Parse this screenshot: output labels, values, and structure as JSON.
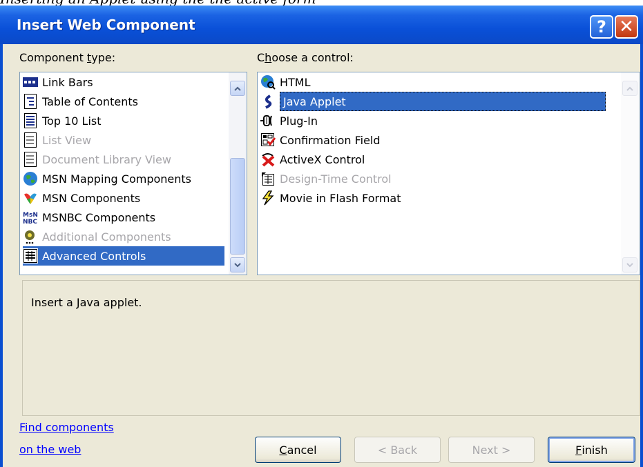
{
  "caption": "Inserting an Applet using the the active form",
  "window": {
    "title": "Insert Web Component",
    "help_glyph": "?",
    "close_glyph": "✕"
  },
  "component_type": {
    "label_pre": "Component ",
    "label_accel": "t",
    "label_post": "ype:",
    "items": [
      {
        "label": "Link Bars",
        "icon": "link-bars-icon",
        "enabled": true,
        "selected": false
      },
      {
        "label": "Table of Contents",
        "icon": "table-of-contents-icon",
        "enabled": true,
        "selected": false
      },
      {
        "label": "Top 10 List",
        "icon": "top-10-list-icon",
        "enabled": true,
        "selected": false
      },
      {
        "label": "List View",
        "icon": "list-view-icon",
        "enabled": false,
        "selected": false
      },
      {
        "label": "Document Library View",
        "icon": "document-library-icon",
        "enabled": false,
        "selected": false
      },
      {
        "label": "MSN Mapping Components",
        "icon": "globe-icon",
        "enabled": true,
        "selected": false
      },
      {
        "label": "MSN Components",
        "icon": "msn-butterfly-icon",
        "enabled": true,
        "selected": false
      },
      {
        "label": "MSNBC Components",
        "icon": "msnbc-icon",
        "enabled": true,
        "selected": false
      },
      {
        "label": "Additional Components",
        "icon": "gear-icon",
        "enabled": false,
        "selected": false
      },
      {
        "label": "Advanced Controls",
        "icon": "advanced-controls-icon",
        "enabled": true,
        "selected": true
      }
    ]
  },
  "choose_control": {
    "label_pre": "C",
    "label_accel": "h",
    "label_post": "oose a control:",
    "items": [
      {
        "label": "HTML",
        "icon": "html-globe-icon",
        "enabled": true,
        "selected": false
      },
      {
        "label": "Java Applet",
        "icon": "java-applet-icon",
        "enabled": true,
        "selected": true
      },
      {
        "label": "Plug-In",
        "icon": "plug-in-icon",
        "enabled": true,
        "selected": false
      },
      {
        "label": "Confirmation Field",
        "icon": "confirmation-field-icon",
        "enabled": true,
        "selected": false
      },
      {
        "label": "ActiveX Control",
        "icon": "activex-icon",
        "enabled": true,
        "selected": false
      },
      {
        "label": "Design-Time Control",
        "icon": "design-time-icon",
        "enabled": false,
        "selected": false
      },
      {
        "label": "Movie in Flash Format",
        "icon": "flash-movie-icon",
        "enabled": true,
        "selected": false
      }
    ]
  },
  "description": "Insert a Java applet.",
  "find_link": {
    "line1": "Find components",
    "line2": "on the web"
  },
  "buttons": {
    "cancel": {
      "accel": "C",
      "rest": "ancel"
    },
    "back": "< Back",
    "next": "Next >",
    "finish": {
      "accel": "F",
      "rest": "inish"
    }
  },
  "colors": {
    "title_blue": "#0a50d8",
    "selection": "#316ac5",
    "link": "#0000ff",
    "disabled_text": "#a7a6aa"
  }
}
